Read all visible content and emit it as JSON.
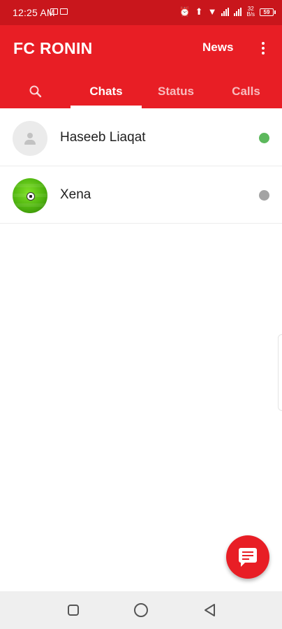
{
  "status_bar": {
    "time": "12:25 AM",
    "network_speed_value": "32",
    "network_speed_unit": "B/s",
    "battery_level": "59"
  },
  "app_bar": {
    "title": "FC RONIN",
    "news_label": "News"
  },
  "tabs": [
    {
      "label": "Chats",
      "active": true
    },
    {
      "label": "Status",
      "active": false
    },
    {
      "label": "Calls",
      "active": false
    }
  ],
  "chats": [
    {
      "name": "Haseeb Liaqat",
      "avatar": "default-person-icon",
      "presence_color": "#5cb85c"
    },
    {
      "name": "Xena",
      "avatar": "soccer-ball-icon",
      "presence_color": "#a3a3a3"
    }
  ],
  "colors": {
    "primary": "#e81e25",
    "status_bar": "#c9161c",
    "online": "#5cb85c",
    "offline": "#a3a3a3"
  },
  "icons": {
    "search": "search-icon",
    "more": "more-vertical-icon",
    "fab": "new-chat-icon",
    "nav_recents": "square-icon",
    "nav_home": "circle-icon",
    "nav_back": "triangle-back-icon"
  }
}
